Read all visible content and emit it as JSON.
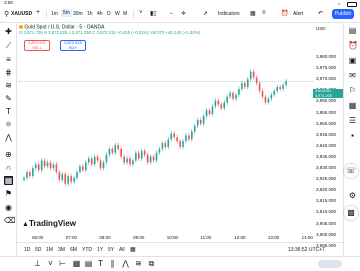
{
  "status": {
    "time": "3:58",
    "battery_icon": "battery-icon",
    "wifi_icon": "wifi-icon"
  },
  "topbar": {
    "symbol": "XAUUSD",
    "intervals": [
      "1m",
      "5m",
      "30m",
      "1h",
      "4h",
      "D",
      "W",
      "M"
    ],
    "active_interval": "5m",
    "indicators_label": "Indicators",
    "alert_label": "Alert",
    "publish_label": "Publish"
  },
  "legend": {
    "title": "Gold Spot / U.S. Dollar · 5 · OANDA",
    "ohlc": "O 3,871.725  H 3,872.825  L 3,871.250  C 3,872.215  +0.425 (+0.01%)  Vol 370  +40.140 (+1.02%)",
    "sell_price": "3,871.997",
    "sell_label": "SELL",
    "buy_price": "3,872.615",
    "buy_label": "BUY"
  },
  "price_axis": {
    "currency": "USD",
    "labels": [
      "3,980.000",
      "3,975.000",
      "3,970.000",
      "3,965.000",
      "3,960.000",
      "3,955.000",
      "3,950.000",
      "3,945.000",
      "3,940.000",
      "3,935.000",
      "3,930.000",
      "3,925.000",
      "3,920.000",
      "3,915.000",
      "3,910.000",
      "3,905.000",
      "3,900.000",
      "3,895.000"
    ],
    "current_symbol": "XAUUSD",
    "current_price": "3,971.205"
  },
  "time_axis": {
    "labels": [
      "06:00",
      "07:00",
      "08:00",
      "09:00",
      "10:00",
      "11:00",
      "12:00",
      "13:00",
      "14:00"
    ]
  },
  "watermark": "TradingView",
  "bottombar": {
    "ranges": [
      "1D",
      "5D",
      "1M",
      "3M",
      "6M",
      "YTD",
      "1Y",
      "5Y",
      "All"
    ],
    "clock": "13:36:52 UTC+7"
  },
  "colors": {
    "up": "#26a69a",
    "down": "#ef5350",
    "accent": "#2962ff"
  },
  "chart_data": {
    "type": "candlestick",
    "x_labels": [
      "06:00",
      "07:00",
      "08:00",
      "09:00",
      "10:00",
      "11:00",
      "12:00",
      "13:00",
      "14:00"
    ],
    "ylim": [
      3893,
      3982
    ],
    "close": [
      3921,
      3924,
      3922,
      3926,
      3928,
      3925,
      3930,
      3927,
      3929,
      3926,
      3928,
      3924,
      3920,
      3923,
      3918,
      3922,
      3919,
      3921,
      3924,
      3927,
      3925,
      3929,
      3931,
      3928,
      3932,
      3930,
      3926,
      3929,
      3933,
      3936,
      3934,
      3938,
      3936,
      3932,
      3929,
      3931,
      3928,
      3930,
      3934,
      3931,
      3935,
      3933,
      3929,
      3932,
      3930,
      3934,
      3936,
      3939,
      3937,
      3941,
      3944,
      3942,
      3940,
      3937,
      3940,
      3943,
      3941,
      3945,
      3948,
      3951,
      3949,
      3953,
      3956,
      3954,
      3958,
      3961,
      3959,
      3957,
      3960,
      3963,
      3965,
      3962,
      3964,
      3967,
      3970,
      3968,
      3972,
      3976,
      3973,
      3970,
      3966,
      3963,
      3960,
      3962,
      3964,
      3966,
      3968,
      3967,
      3969,
      3971
    ]
  }
}
